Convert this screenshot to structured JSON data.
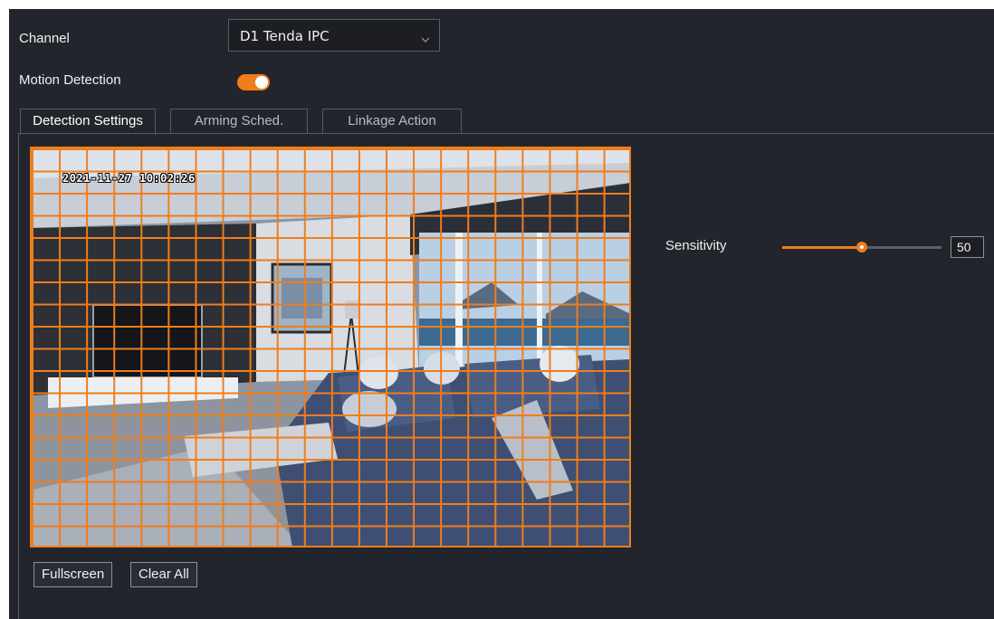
{
  "form": {
    "channel_label": "Channel",
    "channel_value": "D1 Tenda IPC",
    "motion_label": "Motion Detection",
    "motion_enabled": true
  },
  "tabs": [
    {
      "label": "Detection Settings",
      "active": true
    },
    {
      "label": "Arming Sched.",
      "active": false
    },
    {
      "label": "Linkage Action",
      "active": false
    }
  ],
  "video": {
    "timestamp": "2021-11-27 10:02:26",
    "grid_columns": 22,
    "grid_rows": 18
  },
  "buttons": {
    "fullscreen": "Fullscreen",
    "clear_all": "Clear All"
  },
  "sensitivity": {
    "label": "Sensitivity",
    "value": "50",
    "fraction": 0.5
  },
  "colors": {
    "accent": "#f07d1c",
    "background": "#23252d"
  },
  "icons": {
    "dropdown": "chevron-down-icon"
  }
}
